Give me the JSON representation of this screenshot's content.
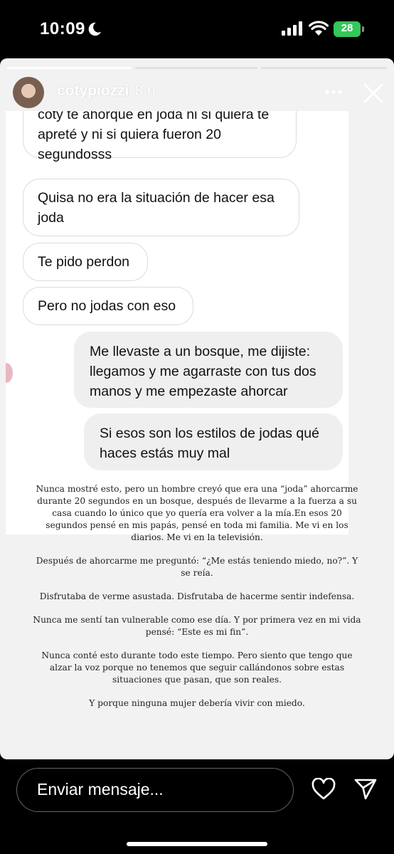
{
  "status_bar": {
    "time": "10:09",
    "battery": "28"
  },
  "story": {
    "username": "cotypiozzi",
    "time_ago": "8 h"
  },
  "chat": {
    "messages": [
      {
        "from": "other",
        "text": "coty te ahorque en joda ni si quiera te apreté y ni si quiera fueron 20 segundosss"
      },
      {
        "from": "other",
        "text": "Quisa no era la situación de hacer esa joda"
      },
      {
        "from": "other",
        "text": "Te pido perdon"
      },
      {
        "from": "other",
        "text": "Pero no jodas con eso"
      },
      {
        "from": "me",
        "text": "Me llevaste a un bosque, me dijiste: llegamos y me agarraste con tus dos manos y me empezaste  ahorcar"
      },
      {
        "from": "me",
        "text": "Si esos son los estilos de jodas qué haces estás muy mal"
      }
    ]
  },
  "caption": [
    "Nunca mostré esto, pero un hombre creyó que era una “joda” ahorcarme durante 20 segundos en un bosque, después de llevarme a la fuerza a su casa cuando lo único que yo quería era volver a la mía.En esos 20 segundos pensé en mis papás, pensé en toda mi familia. Me vi en los diarios. Me vi en la televisión.",
    "Después de ahorcarme me preguntó: “¿Me estás teniendo miedo, no?”. Y se reía.",
    "Disfrutaba de verme asustada. Disfrutaba de hacerme sentir indefensa.",
    "Nunca me sentí tan vulnerable como ese día. Y por primera vez en mi vida pensé: “Este es mi fin”.",
    "Nunca conté esto durante todo este tiempo. Pero siento que tengo que alzar la voz porque no tenemos que seguir callándonos sobre estas situaciones que pasan, que son reales.",
    "Y porque ninguna mujer debería vivir con miedo."
  ],
  "reply": {
    "placeholder": "Enviar mensaje..."
  },
  "icons": {
    "moon": "moon-icon",
    "signal": "cellular-signal-icon",
    "wifi": "wifi-icon",
    "battery": "battery-charging-icon",
    "more": "more-dots-icon",
    "close": "close-icon",
    "heart": "heart-icon",
    "send": "send-icon"
  },
  "colors": {
    "battery": "#34c759",
    "story_background": "#f2f2f2",
    "outgoing_bubble": "#efefef"
  }
}
